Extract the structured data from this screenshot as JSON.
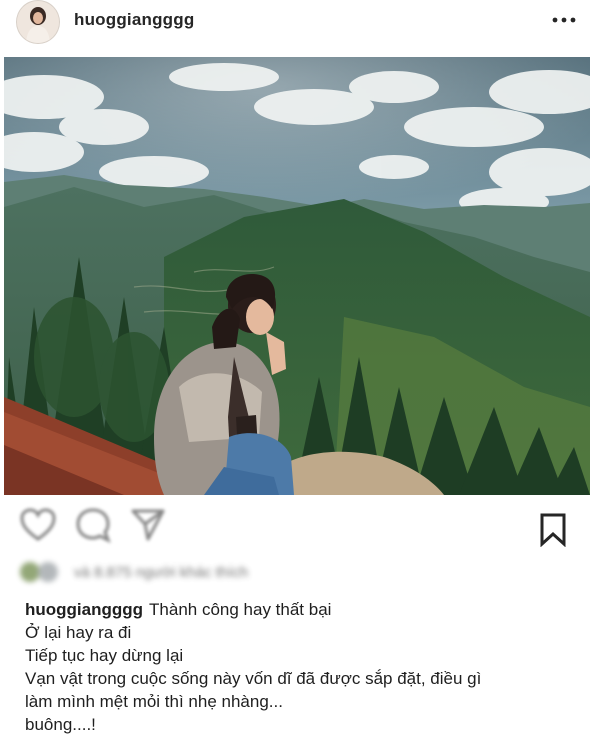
{
  "post": {
    "username": "huoggiangggg",
    "more_icon": "more-horizontal-icon"
  },
  "actions": {
    "icons": [
      "heart-icon",
      "comment-icon",
      "share-icon",
      "bookmark-icon"
    ]
  },
  "likes": {
    "text": "và 8.875 người khác thích"
  },
  "caption": {
    "username": "huoggiangggg",
    "line1": "Thành công hay thất bại",
    "line2": "Ở lại hay ra đi",
    "line3": "Tiếp tục hay dừng lại",
    "line4": "Vạn vật trong cuộc sống này vốn dĩ đã được sắp đặt, điều gì",
    "line5": "làm mình mệt mỏi thì nhẹ nhàng...",
    "line6": "buông....!"
  },
  "colors": {
    "text": "#262626",
    "background": "#ffffff",
    "sky": "#6f8d99",
    "mountain": "#2f5a3a"
  }
}
